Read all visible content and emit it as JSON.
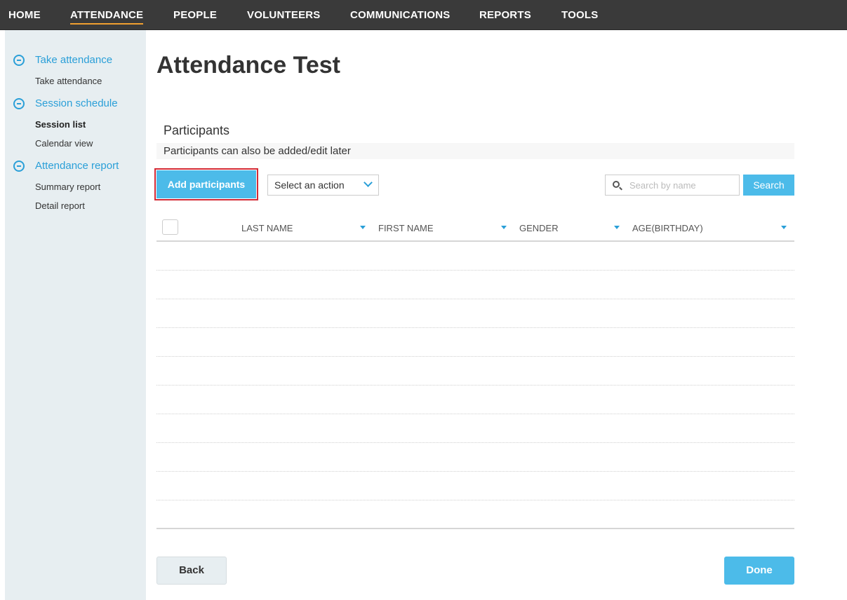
{
  "nav": {
    "items": [
      {
        "label": "HOME"
      },
      {
        "label": "ATTENDANCE",
        "active": true
      },
      {
        "label": "PEOPLE"
      },
      {
        "label": "VOLUNTEERS"
      },
      {
        "label": "COMMUNICATIONS"
      },
      {
        "label": "REPORTS"
      },
      {
        "label": "TOOLS"
      }
    ]
  },
  "sidebar": {
    "sections": [
      {
        "label": "Take attendance",
        "icon": "minus-circle-icon",
        "items": [
          {
            "label": "Take attendance"
          }
        ]
      },
      {
        "label": "Session schedule",
        "icon": "minus-circle-icon",
        "items": [
          {
            "label": "Session list",
            "current": true
          },
          {
            "label": "Calendar view"
          }
        ]
      },
      {
        "label": "Attendance report",
        "icon": "minus-circle-icon",
        "items": [
          {
            "label": "Summary report"
          },
          {
            "label": "Detail report"
          }
        ]
      }
    ]
  },
  "page": {
    "title": "Attendance Test",
    "participants_heading": "Participants",
    "participants_note": "Participants can also be added/edit later"
  },
  "toolbar": {
    "add_label": "Add participants",
    "action_select": "Select an action",
    "search_placeholder": "Search by name",
    "search_label": "Search"
  },
  "table": {
    "columns": [
      {
        "label": "LAST NAME"
      },
      {
        "label": "FIRST NAME"
      },
      {
        "label": "GENDER"
      },
      {
        "label": "AGE(BIRTHDAY)"
      }
    ],
    "rows": []
  },
  "footer": {
    "back_label": "Back",
    "done_label": "Done"
  },
  "colors": {
    "accent": "#4cbbe9",
    "link": "#2a9fd8",
    "nav_bg": "#3a3a3a",
    "sidebar_bg": "#e7eef1",
    "highlight": "#d42a35"
  }
}
